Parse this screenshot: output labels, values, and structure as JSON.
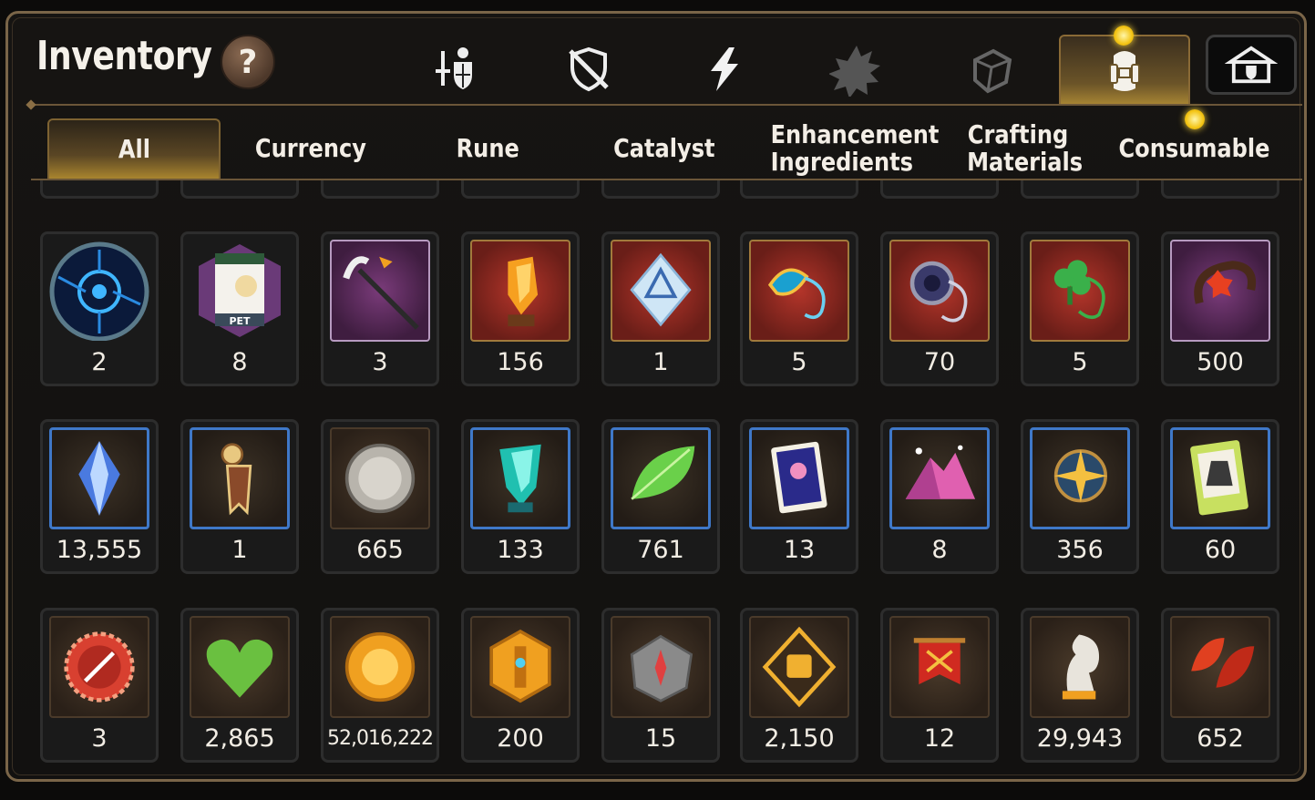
{
  "header": {
    "title": "Inventory",
    "help_label": "?",
    "category_tabs": [
      {
        "icon": "hero-equipment-icon"
      },
      {
        "icon": "artifact-icon"
      },
      {
        "icon": "lightning-icon"
      },
      {
        "icon": "gear-burst-icon"
      },
      {
        "icon": "box-icon"
      },
      {
        "icon": "backpack-icon",
        "active": true
      }
    ],
    "shop_icon": "shop-icon"
  },
  "filters": {
    "all": "All",
    "currency": "Currency",
    "rune": "Rune",
    "catalyst": "Catalyst",
    "enhancement": "Enhancement Ingredients",
    "crafting": "Crafting Materials",
    "consumable": "Consumable"
  },
  "items": {
    "row1": [
      "2",
      "8",
      "3",
      "156",
      "1",
      "5",
      "70",
      "5",
      "500"
    ],
    "row2": [
      "13,555",
      "1",
      "665",
      "133",
      "761",
      "13",
      "8",
      "356",
      "60"
    ],
    "row3": [
      "3",
      "2,865",
      "52,016,222",
      "200",
      "15",
      "2,150",
      "12",
      "29,943",
      "652"
    ]
  },
  "colors": {
    "gold_accent": "#a9852e",
    "frame": "#7a6548",
    "notification": "#f3c414"
  }
}
